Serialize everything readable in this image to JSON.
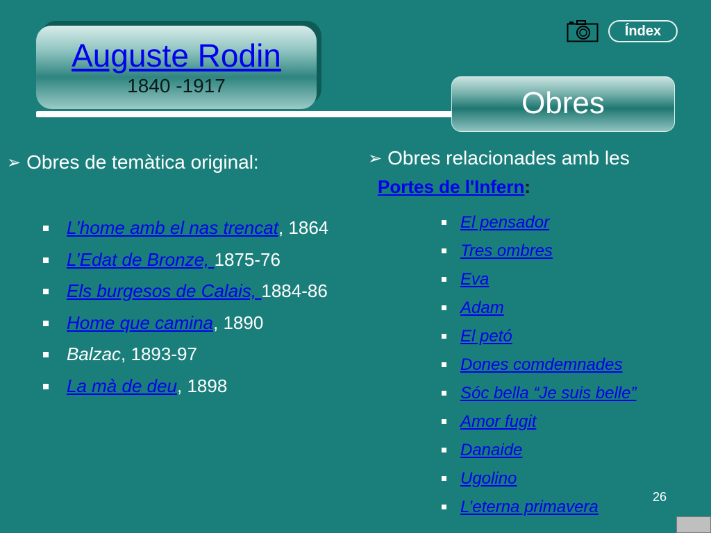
{
  "title": {
    "name": "Auguste Rodin",
    "years": "1840 -1917"
  },
  "section_title": "Obres",
  "index_button": "Índex",
  "left_heading": "Obres de temàtica original:",
  "left_items": [
    {
      "link": "L’home amb el nas trencat",
      "rest": ", 1864"
    },
    {
      "link": "L’Edat de Bronze, ",
      "rest": "1875-76"
    },
    {
      "link": "Els burgesos de Calais, ",
      "rest": "1884-86"
    },
    {
      "link": "Home que camina",
      "rest": ", 1890"
    },
    {
      "plain": "Balzac",
      "rest": ", 1893-97"
    },
    {
      "link": "La mà de deu",
      "rest": ", 1898"
    }
  ],
  "right_heading": {
    "text": "Obres relacionades amb les",
    "link": "Portes de l'Infern",
    "colon": ":"
  },
  "right_items": [
    "El pensador",
    "Tres ombres",
    "Eva",
    "Adam",
    "El petó",
    "Dones comdemnades",
    "Sóc bella “Je suis belle”",
    "Amor fugit",
    "Danaide",
    "Ugolino",
    "L’eterna primavera"
  ],
  "page_number": "26",
  "icons": {
    "camera": "camera-icon",
    "heading_arrow": "arrow-bullet-icon",
    "item_bullet": "square-bullet-icon"
  }
}
